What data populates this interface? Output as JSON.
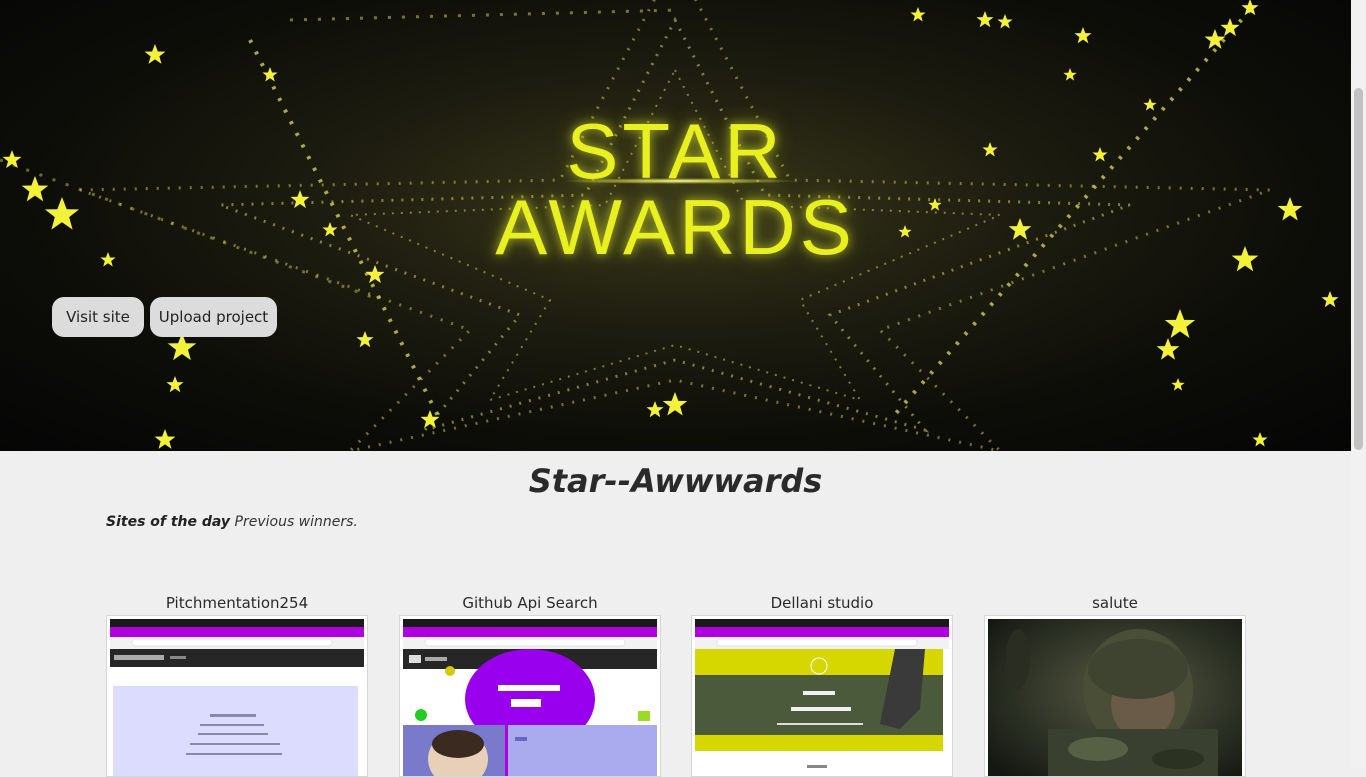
{
  "hero": {
    "title_line1": "STAR",
    "title_line2": "AWARDS",
    "visit_label": "Visit site",
    "upload_label": "Upload project"
  },
  "main": {
    "title": "Star--Awwwards",
    "sites_label": "Sites of the day",
    "previous_label": "Previous winners."
  },
  "projects": [
    {
      "title": "Pitchmentation254"
    },
    {
      "title": "Github Api Search"
    },
    {
      "title": "Dellani studio"
    },
    {
      "title": "salute"
    }
  ],
  "colors": {
    "accent_yellow": "#e8f020",
    "button_bg": "#dcdcdc",
    "page_bg": "#efefef",
    "browser_bar": "#b000e0"
  },
  "icons": [
    "star-icon"
  ]
}
